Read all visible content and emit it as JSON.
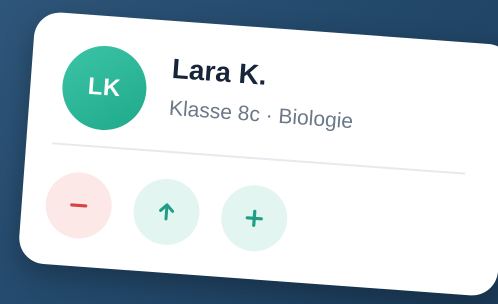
{
  "student": {
    "initials": "LK",
    "name": "Lara K.",
    "subtitle": "Klasse 8c · Biologie"
  },
  "actions": [
    {
      "icon": "minus-icon",
      "color": "#d64545"
    },
    {
      "icon": "arrow-up-icon",
      "color": "#1e9e84"
    },
    {
      "icon": "plus-icon",
      "color": "#1e9e84"
    }
  ],
  "colors": {
    "avatar": "#2bb899",
    "accent_green": "#1e9e84",
    "accent_red": "#d64545",
    "name_text": "#17253a",
    "subtitle_text": "#6c7888"
  }
}
